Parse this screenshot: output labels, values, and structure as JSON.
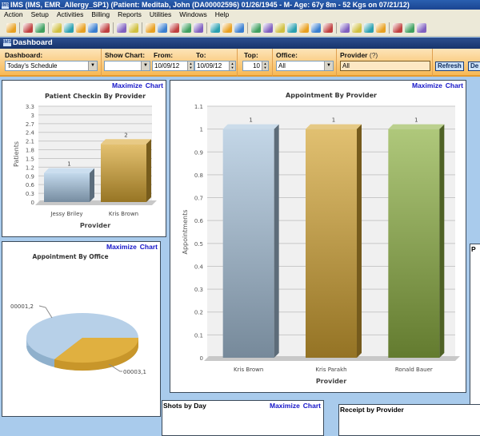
{
  "window": {
    "title": "IMS (IMS, EMR_Allergy_SP1)   (Patient: Meditab, John  (DA00002596) 01/26/1945 - M- Age: 67y 8m - 52 Kgs on 07/21/12)",
    "logo": "IMS"
  },
  "menu": [
    "Action",
    "Setup",
    "Activities",
    "Billing",
    "Reports",
    "Utilities",
    "Windows",
    "Help"
  ],
  "toolbar_icons": [
    "user-icon",
    "sep",
    "doctor-icon",
    "edit-user-icon",
    "sep",
    "folder-icon",
    "notes-icon",
    "lab-user-icon",
    "rx-icon",
    "flask-icon",
    "sep",
    "document-icon",
    "form-icon",
    "sep",
    "dollar-icon",
    "payment-icon",
    "billing-icon",
    "claims-icon",
    "ledger-icon",
    "sep",
    "calendar-icon",
    "tasks-icon",
    "alert-icon",
    "sep",
    "fax-icon",
    "globe-icon",
    "mail-icon",
    "letter-icon",
    "report-icon",
    "chart-icon",
    "fileset-icon",
    "sep",
    "scan-icon",
    "image-icon",
    "injection-icon",
    "allergy-icon",
    "sep",
    "pencil-icon",
    "refresh-icon",
    "word-icon"
  ],
  "dashboard": {
    "title": "Dashboard",
    "filters": {
      "dashboard_label": "Dashboard:",
      "dashboard_value": "Today's Schedule",
      "show_chart_label": "Show Chart:",
      "show_chart_value": "",
      "from_label": "From:",
      "from_value": "10/09/12",
      "to_label": "To:",
      "to_value": "10/09/12",
      "top_label": "Top:",
      "top_value": "10",
      "office_label": "Office:",
      "office_value": "All",
      "provider_label": "Provider",
      "provider_help": "(?)",
      "provider_value": "All",
      "refresh": "Refresh",
      "default": "De"
    },
    "maximize": "Maximize",
    "chart": "Chart",
    "panels": {
      "shots_title": "Shots by Day",
      "receipt_title": "Receipt by Provider",
      "right_partial": "P"
    }
  },
  "chart_data": [
    {
      "type": "bar",
      "title": "Patient Checkin By Provider",
      "xlabel": "Provider",
      "ylabel": "Patients",
      "categories": [
        "Jessy Briley",
        "Kris Brown"
      ],
      "values": [
        1,
        2
      ],
      "data_labels": [
        "1",
        "2"
      ],
      "ylim": [
        0,
        3.3
      ],
      "yticks": [
        "0",
        "0.3",
        "0.6",
        "0.9",
        "1.2",
        "1.5",
        "1.8",
        "2.1",
        "2.4",
        "2.7",
        "3",
        "3.3"
      ],
      "colors": [
        "#a9c8e4",
        "#d8a733"
      ],
      "grid": true
    },
    {
      "type": "bar",
      "title": "Appointment By Provider",
      "xlabel": "Provider",
      "ylabel": "Appointments",
      "categories": [
        "Kris Brown",
        "Kris Parakh",
        "Ronald Bauer"
      ],
      "values": [
        1,
        1,
        1
      ],
      "data_labels": [
        "1",
        "1",
        "1"
      ],
      "ylim": [
        0,
        1.1
      ],
      "yticks": [
        "0",
        "0.1",
        "0.2",
        "0.3",
        "0.4",
        "0.5",
        "0.6",
        "0.7",
        "0.8",
        "0.9",
        "1",
        "1.1"
      ],
      "colors": [
        "#a9c4dc",
        "#d4a534",
        "#8db043"
      ],
      "grid": true
    },
    {
      "type": "pie",
      "title": "Appointment By Office",
      "labels": [
        "00001,2",
        "00003,1"
      ],
      "values": [
        2,
        1
      ],
      "colors": [
        "#b7d0e8",
        "#e0b040"
      ]
    }
  ]
}
